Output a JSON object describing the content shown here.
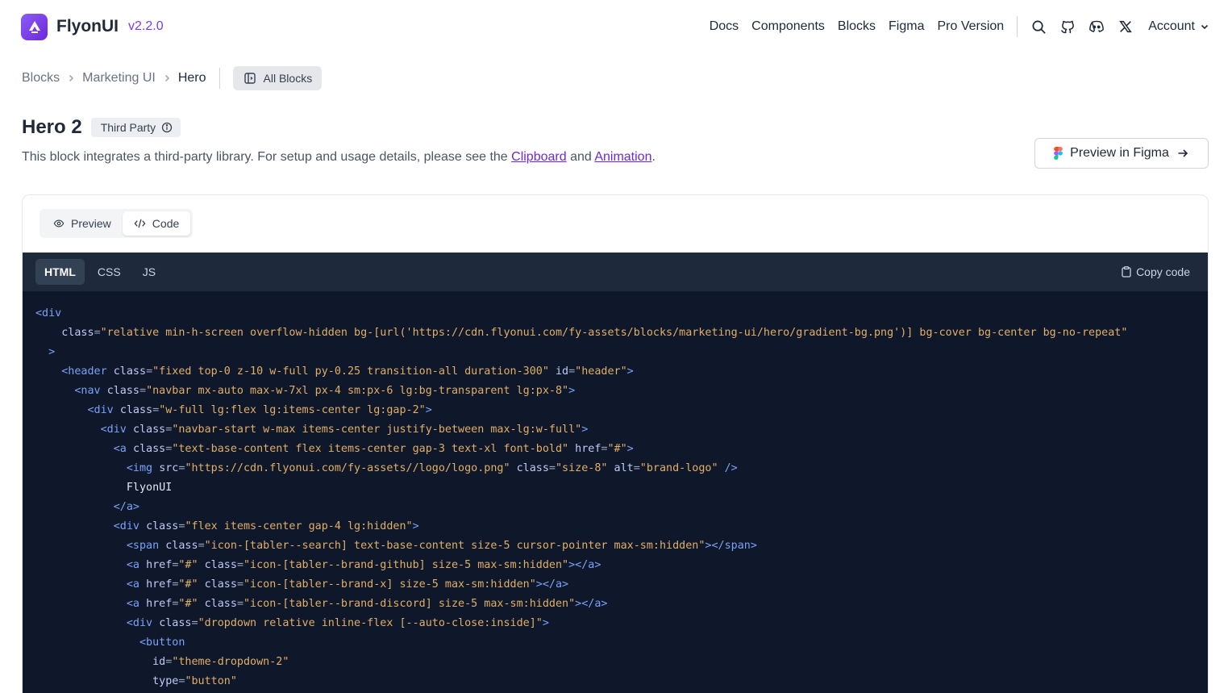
{
  "brand": {
    "name": "FlyonUI",
    "version": "v2.2.0"
  },
  "nav": {
    "links": [
      "Docs",
      "Components",
      "Blocks",
      "Figma",
      "Pro Version"
    ],
    "account": "Account",
    "icons": [
      "search-icon",
      "github-icon",
      "discord-icon",
      "x-icon"
    ]
  },
  "breadcrumb": {
    "items": [
      "Blocks",
      "Marketing UI",
      "Hero"
    ],
    "all_blocks": "All Blocks"
  },
  "block": {
    "title": "Hero 2",
    "badge": "Third Party",
    "desc_pre": "This block integrates a third-party library. For setup and usage details, please see the ",
    "link1": "Clipboard",
    "desc_mid": " and ",
    "link2": "Animation",
    "desc_post": ".",
    "figma_button": "Preview in Figma"
  },
  "tabs": {
    "preview": "Preview",
    "code": "Code",
    "active": "Code"
  },
  "code_tabs": {
    "items": [
      "HTML",
      "CSS",
      "JS"
    ],
    "active": "HTML",
    "copy": "Copy code"
  },
  "code_lines": [
    [
      [
        "tag",
        "<div"
      ]
    ],
    [
      [
        "txt",
        "    "
      ],
      [
        "attr",
        "class"
      ],
      [
        "punc",
        "="
      ],
      [
        "val",
        "\"relative min-h-screen overflow-hidden bg-[url('https://cdn.flyonui.com/fy-assets/blocks/marketing-ui/hero/gradient-bg.png')] bg-cover bg-center bg-no-repeat\""
      ]
    ],
    [
      [
        "txt",
        "  "
      ],
      [
        "tag",
        ">"
      ]
    ],
    [
      [
        "txt",
        "    "
      ],
      [
        "tag",
        "<header "
      ],
      [
        "attr",
        "class"
      ],
      [
        "punc",
        "="
      ],
      [
        "val",
        "\"fixed top-0 z-10 w-full py-0.25 transition-all duration-300\""
      ],
      [
        "txt",
        " "
      ],
      [
        "attr",
        "id"
      ],
      [
        "punc",
        "="
      ],
      [
        "val",
        "\"header\""
      ],
      [
        "tag",
        ">"
      ]
    ],
    [
      [
        "txt",
        "      "
      ],
      [
        "tag",
        "<nav "
      ],
      [
        "attr",
        "class"
      ],
      [
        "punc",
        "="
      ],
      [
        "val",
        "\"navbar mx-auto max-w-7xl px-4 sm:px-6 lg:bg-transparent lg:px-8\""
      ],
      [
        "tag",
        ">"
      ]
    ],
    [
      [
        "txt",
        "        "
      ],
      [
        "tag",
        "<div "
      ],
      [
        "attr",
        "class"
      ],
      [
        "punc",
        "="
      ],
      [
        "val",
        "\"w-full lg:flex lg:items-center lg:gap-2\""
      ],
      [
        "tag",
        ">"
      ]
    ],
    [
      [
        "txt",
        "          "
      ],
      [
        "tag",
        "<div "
      ],
      [
        "attr",
        "class"
      ],
      [
        "punc",
        "="
      ],
      [
        "val",
        "\"navbar-start w-max items-center justify-between max-lg:w-full\""
      ],
      [
        "tag",
        ">"
      ]
    ],
    [
      [
        "txt",
        "            "
      ],
      [
        "tag",
        "<a "
      ],
      [
        "attr",
        "class"
      ],
      [
        "punc",
        "="
      ],
      [
        "val",
        "\"text-base-content flex items-center gap-3 text-xl font-bold\""
      ],
      [
        "txt",
        " "
      ],
      [
        "attr",
        "href"
      ],
      [
        "punc",
        "="
      ],
      [
        "val",
        "\"#\""
      ],
      [
        "tag",
        ">"
      ]
    ],
    [
      [
        "txt",
        "              "
      ],
      [
        "tag",
        "<img "
      ],
      [
        "attr",
        "src"
      ],
      [
        "punc",
        "="
      ],
      [
        "val",
        "\"https://cdn.flyonui.com/fy-assets//logo/logo.png\""
      ],
      [
        "txt",
        " "
      ],
      [
        "attr",
        "class"
      ],
      [
        "punc",
        "="
      ],
      [
        "val",
        "\"size-8\""
      ],
      [
        "txt",
        " "
      ],
      [
        "attr",
        "alt"
      ],
      [
        "punc",
        "="
      ],
      [
        "val",
        "\"brand-logo\""
      ],
      [
        "tag",
        " />"
      ]
    ],
    [
      [
        "txt",
        "              FlyonUI"
      ]
    ],
    [
      [
        "txt",
        "            "
      ],
      [
        "tag",
        "</a>"
      ]
    ],
    [
      [
        "txt",
        "            "
      ],
      [
        "tag",
        "<div "
      ],
      [
        "attr",
        "class"
      ],
      [
        "punc",
        "="
      ],
      [
        "val",
        "\"flex items-center gap-4 lg:hidden\""
      ],
      [
        "tag",
        ">"
      ]
    ],
    [
      [
        "txt",
        "              "
      ],
      [
        "tag",
        "<span "
      ],
      [
        "attr",
        "class"
      ],
      [
        "punc",
        "="
      ],
      [
        "val",
        "\"icon-[tabler--search] text-base-content size-5 cursor-pointer max-sm:hidden\""
      ],
      [
        "tag",
        "></span>"
      ]
    ],
    [
      [
        "txt",
        "              "
      ],
      [
        "tag",
        "<a "
      ],
      [
        "attr",
        "href"
      ],
      [
        "punc",
        "="
      ],
      [
        "val",
        "\"#\""
      ],
      [
        "txt",
        " "
      ],
      [
        "attr",
        "class"
      ],
      [
        "punc",
        "="
      ],
      [
        "val",
        "\"icon-[tabler--brand-github] size-5 max-sm:hidden\""
      ],
      [
        "tag",
        "></a>"
      ]
    ],
    [
      [
        "txt",
        "              "
      ],
      [
        "tag",
        "<a "
      ],
      [
        "attr",
        "href"
      ],
      [
        "punc",
        "="
      ],
      [
        "val",
        "\"#\""
      ],
      [
        "txt",
        " "
      ],
      [
        "attr",
        "class"
      ],
      [
        "punc",
        "="
      ],
      [
        "val",
        "\"icon-[tabler--brand-x] size-5 max-sm:hidden\""
      ],
      [
        "tag",
        "></a>"
      ]
    ],
    [
      [
        "txt",
        "              "
      ],
      [
        "tag",
        "<a "
      ],
      [
        "attr",
        "href"
      ],
      [
        "punc",
        "="
      ],
      [
        "val",
        "\"#\""
      ],
      [
        "txt",
        " "
      ],
      [
        "attr",
        "class"
      ],
      [
        "punc",
        "="
      ],
      [
        "val",
        "\"icon-[tabler--brand-discord] size-5 max-sm:hidden\""
      ],
      [
        "tag",
        "></a>"
      ]
    ],
    [
      [
        "txt",
        "              "
      ],
      [
        "tag",
        "<div "
      ],
      [
        "attr",
        "class"
      ],
      [
        "punc",
        "="
      ],
      [
        "val",
        "\"dropdown relative inline-flex [--auto-close:inside]\""
      ],
      [
        "tag",
        ">"
      ]
    ],
    [
      [
        "txt",
        "                "
      ],
      [
        "tag",
        "<button"
      ]
    ],
    [
      [
        "txt",
        "                  "
      ],
      [
        "attr",
        "id"
      ],
      [
        "punc",
        "="
      ],
      [
        "val",
        "\"theme-dropdown-2\""
      ]
    ],
    [
      [
        "txt",
        "                  "
      ],
      [
        "attr",
        "type"
      ],
      [
        "punc",
        "="
      ],
      [
        "val",
        "\"button\""
      ]
    ]
  ]
}
